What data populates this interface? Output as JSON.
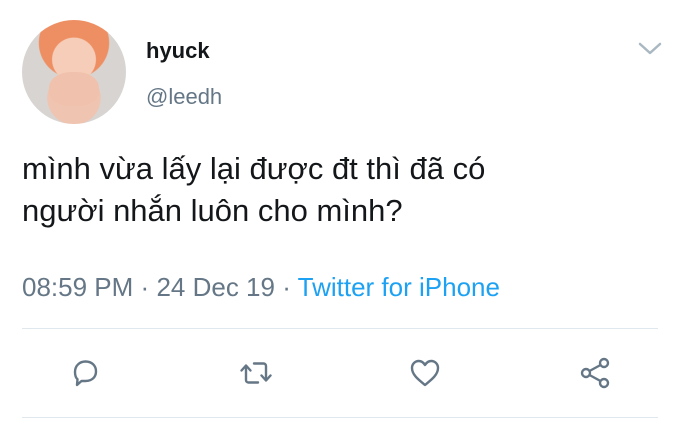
{
  "author": {
    "display_name": "hyuck",
    "handle": "@leedh"
  },
  "tweet": {
    "text_line1": "mình vừa lấy lại được đt thì đã có",
    "text_line2": "người nhắn luôn cho mình?",
    "time": "08:59 PM",
    "date": "24 Dec 19",
    "source": "Twitter for iPhone",
    "separator": "·"
  },
  "icons": {
    "caret": "chevron-down-icon",
    "reply": "reply-icon",
    "retweet": "retweet-icon",
    "like": "heart-icon",
    "share": "share-icon"
  },
  "colors": {
    "text": "#14171a",
    "muted": "#657786",
    "link": "#1da1f2",
    "divider": "#e1e8ed"
  }
}
